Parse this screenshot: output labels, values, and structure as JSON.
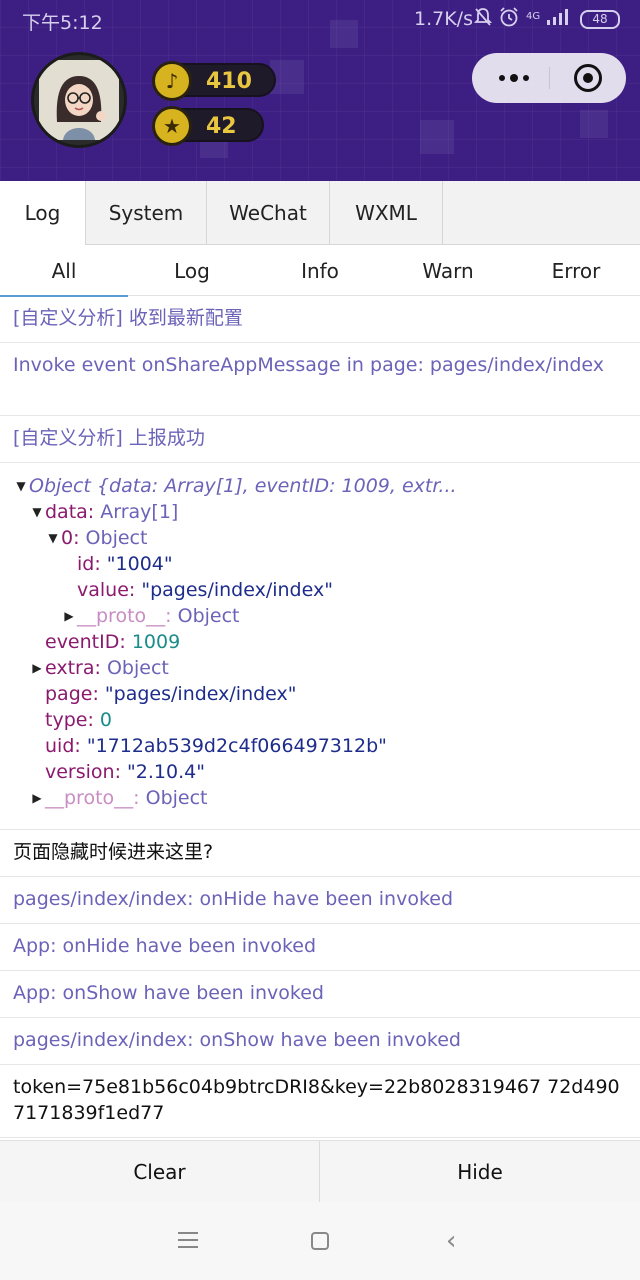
{
  "status_bar": {
    "time": "下午5:12",
    "speed": "1.7K/s",
    "network": "4G",
    "battery": "48"
  },
  "header": {
    "stat_notes": "410",
    "stat_stars": "42"
  },
  "tabs_primary": [
    "Log",
    "System",
    "WeChat",
    "WXML"
  ],
  "tabs_filter": [
    "All",
    "Log",
    "Info",
    "Warn",
    "Error"
  ],
  "logs": {
    "row1": "[自定义分析] 收到最新配置",
    "row2": "Invoke event onShareAppMessage in page: pages/index/index",
    "row3": "[自定义分析] 上报成功",
    "row_hide_question": "页面隐藏时候进来这里?",
    "row_onhide_page": "pages/index/index: onHide have been invoked",
    "row_onhide_app": "App: onHide have been invoked",
    "row_onshow_app": "App: onShow have been invoked",
    "row_onshow_page": "pages/index/index: onShow have been invoked",
    "row_token": "token=75e81b56c04b9btrcDRI8&key=22b8028319467 72d4907171839f1ed77"
  },
  "object": {
    "summary": "Object {data: Array[1], eventID: 1009, extr...",
    "data_key": "data",
    "data_type": "Array[1]",
    "item0_key": "0",
    "item0_type": "Object",
    "id_key": "id",
    "id_val": "\"1004\"",
    "value_key": "value",
    "value_val": "\"pages/index/index\"",
    "proto_key": "__proto__",
    "proto_type": "Object",
    "eventID_key": "eventID",
    "eventID_val": "1009",
    "extra_key": "extra",
    "extra_type": "Object",
    "page_key": "page",
    "page_val": "\"pages/index/index\"",
    "type_key": "type",
    "type_val": "0",
    "uid_key": "uid",
    "uid_val": "\"1712ab539d2c4f066497312b\"",
    "version_key": "version",
    "version_val": "\"2.10.4\""
  },
  "buttons": {
    "clear": "Clear",
    "hide": "Hide"
  },
  "colors": {
    "header_bg": "#3d1f83",
    "log_text": "#6b63b8",
    "key": "#8b1a6e",
    "string": "#1e2d8c",
    "number": "#1a8c8a",
    "tab_underline": "#5a9cd6"
  }
}
